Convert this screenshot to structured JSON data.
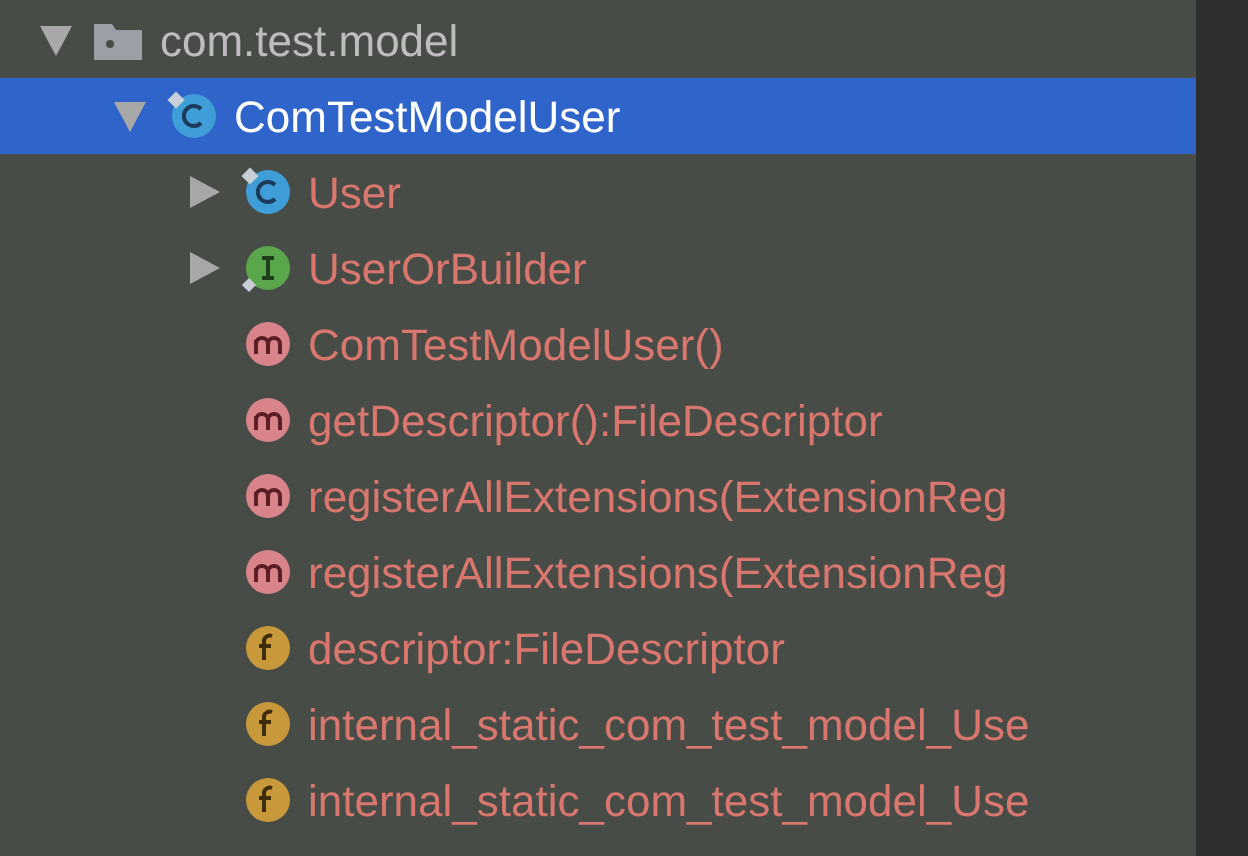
{
  "tree": [
    {
      "kind": "package",
      "label": "com.test.model",
      "expanded": true,
      "selected": false,
      "error": false,
      "children": [
        {
          "kind": "class",
          "label": "ComTestModelUser",
          "expanded": true,
          "selected": true,
          "children": [
            {
              "kind": "class",
              "label": "User",
              "expanded": false,
              "selected": false,
              "error": true
            },
            {
              "kind": "interface",
              "label": "UserOrBuilder",
              "expanded": false,
              "selected": false,
              "error": true
            },
            {
              "kind": "method",
              "label": "ComTestModelUser()",
              "selected": false,
              "error": true
            },
            {
              "kind": "method",
              "label": "getDescriptor():FileDescriptor",
              "selected": false,
              "error": true
            },
            {
              "kind": "method",
              "label": "registerAllExtensions(ExtensionReg",
              "selected": false,
              "error": true
            },
            {
              "kind": "method",
              "label": "registerAllExtensions(ExtensionReg",
              "selected": false,
              "error": true
            },
            {
              "kind": "field",
              "label": "descriptor:FileDescriptor",
              "selected": false,
              "error": true
            },
            {
              "kind": "field",
              "label": "internal_static_com_test_model_Use",
              "selected": false,
              "error": true
            },
            {
              "kind": "field",
              "label": "internal_static_com_test_model_Use",
              "selected": false,
              "error": true
            }
          ]
        }
      ]
    }
  ]
}
